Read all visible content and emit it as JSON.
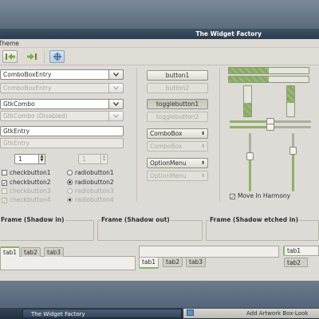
{
  "window": {
    "title": "The Widget Factory"
  },
  "menu": {
    "theme": "Theme"
  },
  "combos": [
    {
      "label": "ComboBoxEntry",
      "disabled": false
    },
    {
      "label": "ComboBoxEntry",
      "disabled": true
    },
    {
      "label": "GtkCombo",
      "disabled": false
    },
    {
      "label": "GtkCombo (Disabled)",
      "disabled": true
    }
  ],
  "entries": {
    "enabled": "GtkEntry",
    "disabled": "GtkEntry"
  },
  "spins": {
    "enabled": "1",
    "disabled": "1"
  },
  "checks": [
    {
      "label": "checkbutton1",
      "checked": false,
      "disabled": false
    },
    {
      "label": "checkbutton2",
      "checked": true,
      "disabled": false
    },
    {
      "label": "checkbutton3",
      "checked": false,
      "disabled": true
    },
    {
      "label": "checkbutton4",
      "checked": true,
      "disabled": true
    }
  ],
  "radios": [
    {
      "label": "radiobutton1",
      "selected": false,
      "disabled": false
    },
    {
      "label": "radiobutton2",
      "selected": true,
      "disabled": false
    },
    {
      "label": "radiobutton3",
      "selected": false,
      "disabled": true
    },
    {
      "label": "radiobutton4",
      "selected": true,
      "disabled": true
    }
  ],
  "buttons": {
    "button1": "button1",
    "button2": "button2",
    "toggle1": "togglebutton1",
    "toggle2": "togglebutton2",
    "combobox": "ComboBox",
    "combobox_dis": "ComboBox",
    "option": "OptionMenu",
    "option_dis": "OptionMenu"
  },
  "progress": {
    "h1": 0.5,
    "h2": 0.5,
    "v1": 0.45,
    "v2": 0.55
  },
  "scales": {
    "h1": 0.5,
    "h2": 0.5,
    "v1": 0.4,
    "v2": 0.3
  },
  "move_harmony": {
    "label": "Move In Harmony",
    "checked": true
  },
  "frames": [
    "Frame (Shadow in)",
    "Frame (Shadow out)",
    "Frame (Shadow etched in)"
  ],
  "tabs": {
    "left": [
      "tab1",
      "tab2",
      "tab3"
    ],
    "bottom": [
      "tab1",
      "tab2",
      "tab3"
    ],
    "right": [
      "tab1",
      "tab2"
    ]
  },
  "taskbar": {
    "window_title": "The Widget Factory",
    "right_item": "Add Artwork Box-Look"
  },
  "colors": {
    "accent_green": "#8fb06a",
    "titlebar": "#2c3d50",
    "window_bg": "#dddbd6"
  }
}
